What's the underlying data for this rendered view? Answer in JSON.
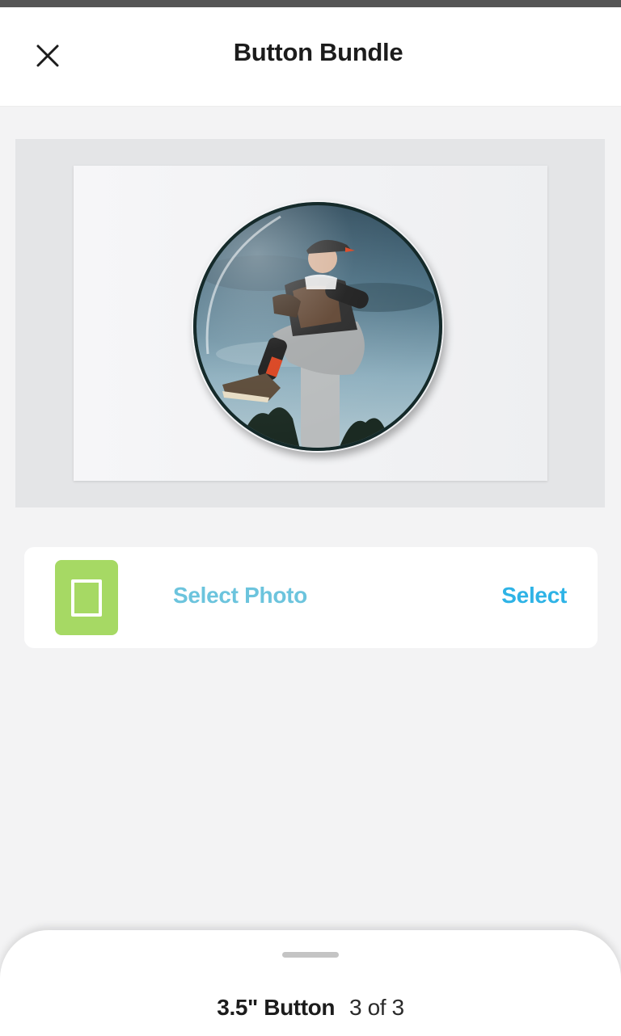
{
  "header": {
    "title": "Button Bundle",
    "close_icon": "close-icon"
  },
  "preview": {
    "image_description": "photo-of-baseball-pitcher-on-round-button"
  },
  "photo_selector": {
    "thumbnail_icon": "photo-frame-icon",
    "label": "Select Photo",
    "action_label": "Select",
    "colors": {
      "thumbnail_bg": "#a6d964",
      "label": "#6cc4dd",
      "action": "#2eb3e6"
    }
  },
  "bottom_sheet": {
    "item_name": "3.5\" Button",
    "item_count": "3 of 3"
  }
}
